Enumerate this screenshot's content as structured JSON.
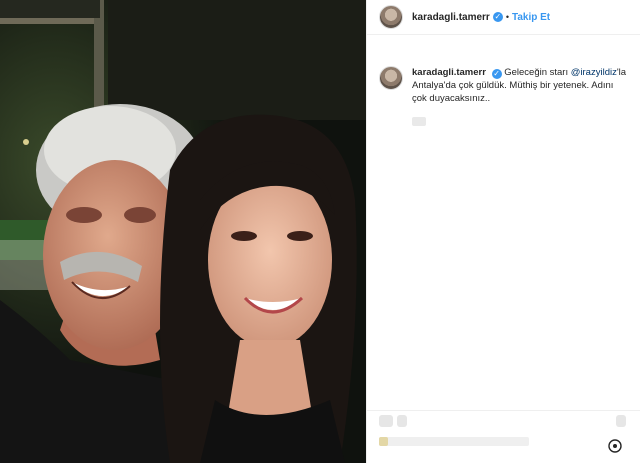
{
  "post": {
    "author": {
      "username": "karadagli.tamerr",
      "verified": true,
      "follow_label": "Takip Et",
      "separator": "•"
    },
    "caption": {
      "username": "karadagli.tamerr",
      "text_before": "Geleceğin starı",
      "mention": "@irazyildiz",
      "text_after": "'la Antalya'da çok güldük. Müthiş bir yetenek. Adını çok duyacaksınız.."
    },
    "icons": {
      "verified_badge": "check-badge-icon",
      "comment_emoji": "emoji-icon",
      "bookmark": "bookmark-icon",
      "add_comment": "add-comment-icon"
    },
    "colors": {
      "link_blue": "#3897f0",
      "mention_blue": "#003569",
      "text": "#262626",
      "divider": "#efefef"
    }
  }
}
